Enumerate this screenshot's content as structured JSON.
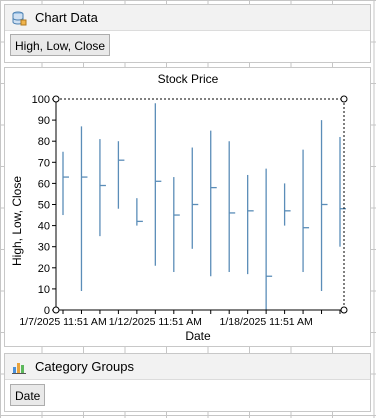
{
  "chart_data_panel": {
    "title": "Chart Data",
    "icon": "database-icon",
    "value_chip": "High, Low, Close"
  },
  "category_groups_panel": {
    "title": "Category Groups",
    "icon": "bar-chart-icon",
    "value_chip": "Date"
  },
  "chart_data": {
    "type": "hlc-stock",
    "title": "Stock Price",
    "xlabel": "Date",
    "ylabel": "High, Low, Close",
    "ylim": [
      0,
      100
    ],
    "yticks": [
      0,
      10,
      20,
      30,
      40,
      50,
      60,
      70,
      80,
      90,
      100
    ],
    "x_tick_labels": [
      "1/7/2025 11:51 AM",
      "1/12/2025 11:51 AM",
      "1/18/2025 11:51 AM"
    ],
    "series_color": "#5b8db8",
    "points": [
      {
        "high": 75,
        "low": 45,
        "close": 63
      },
      {
        "high": 87,
        "low": 9,
        "close": 63
      },
      {
        "high": 81,
        "low": 35,
        "close": 59
      },
      {
        "high": 80,
        "low": 48,
        "close": 71
      },
      {
        "high": 53,
        "low": 40,
        "close": 42
      },
      {
        "high": 98,
        "low": 21,
        "close": 61
      },
      {
        "high": 63,
        "low": 18,
        "close": 45
      },
      {
        "high": 77,
        "low": 29,
        "close": 50
      },
      {
        "high": 85,
        "low": 16,
        "close": 58
      },
      {
        "high": 80,
        "low": 18,
        "close": 46
      },
      {
        "high": 64,
        "low": 17,
        "close": 47
      },
      {
        "high": 67,
        "low": 0,
        "close": 16
      },
      {
        "high": 60,
        "low": 40,
        "close": 47
      },
      {
        "high": 76,
        "low": 18,
        "close": 39
      },
      {
        "high": 90,
        "low": 9,
        "close": 50
      },
      {
        "high": 82,
        "low": 30,
        "close": 48
      }
    ]
  }
}
